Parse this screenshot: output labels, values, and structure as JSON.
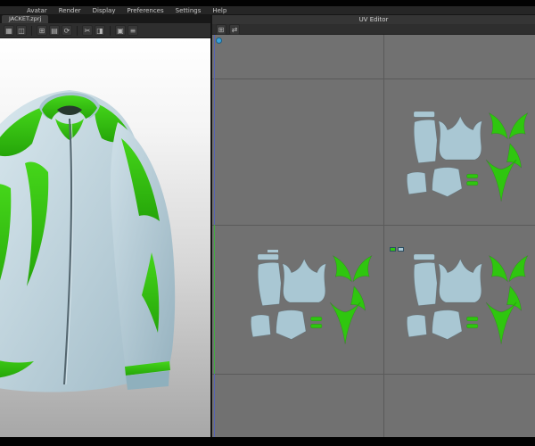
{
  "menu_bar": {
    "items": [
      {
        "label": "Avatar"
      },
      {
        "label": "Render"
      },
      {
        "label": "Display"
      },
      {
        "label": "Preferences"
      },
      {
        "label": "Settings"
      },
      {
        "label": "Help"
      }
    ]
  },
  "tab_bar": {
    "active_tab": "JACKET.zprj"
  },
  "toolbar": {
    "icons": [
      {
        "name": "toolbar-icon-1",
        "glyph": "▦"
      },
      {
        "name": "toolbar-icon-2",
        "glyph": "◫"
      },
      {
        "name": "toolbar-icon-3",
        "glyph": "⊞"
      },
      {
        "name": "toolbar-icon-4",
        "glyph": "▤"
      },
      {
        "name": "toolbar-icon-5",
        "glyph": "⟳"
      },
      {
        "name": "toolbar-icon-6",
        "glyph": "✂"
      },
      {
        "name": "toolbar-icon-7",
        "glyph": "◨"
      },
      {
        "name": "toolbar-icon-8",
        "glyph": "▣"
      },
      {
        "name": "toolbar-icon-9",
        "glyph": "≡"
      }
    ]
  },
  "uv_editor": {
    "title": "UV Editor",
    "toolbar_icons": [
      {
        "name": "uv-grid-icon",
        "glyph": "⊞"
      },
      {
        "name": "uv-swap-icon",
        "glyph": "⇄"
      }
    ]
  },
  "colors": {
    "pattern_blue": "#a9c7d3",
    "pattern_green": "#2fc60f",
    "jacket_blue": "#bdd2da",
    "jacket_green": "#36cb12",
    "uv_background": "#717171",
    "uv_gridline": "#5a5a5a",
    "uv_boundary_blue": "#5663b5",
    "uv_boundary_green": "#3fae3f",
    "viewport_gradient_top": "#ffffff",
    "viewport_gradient_bottom": "#a7a7a7"
  }
}
